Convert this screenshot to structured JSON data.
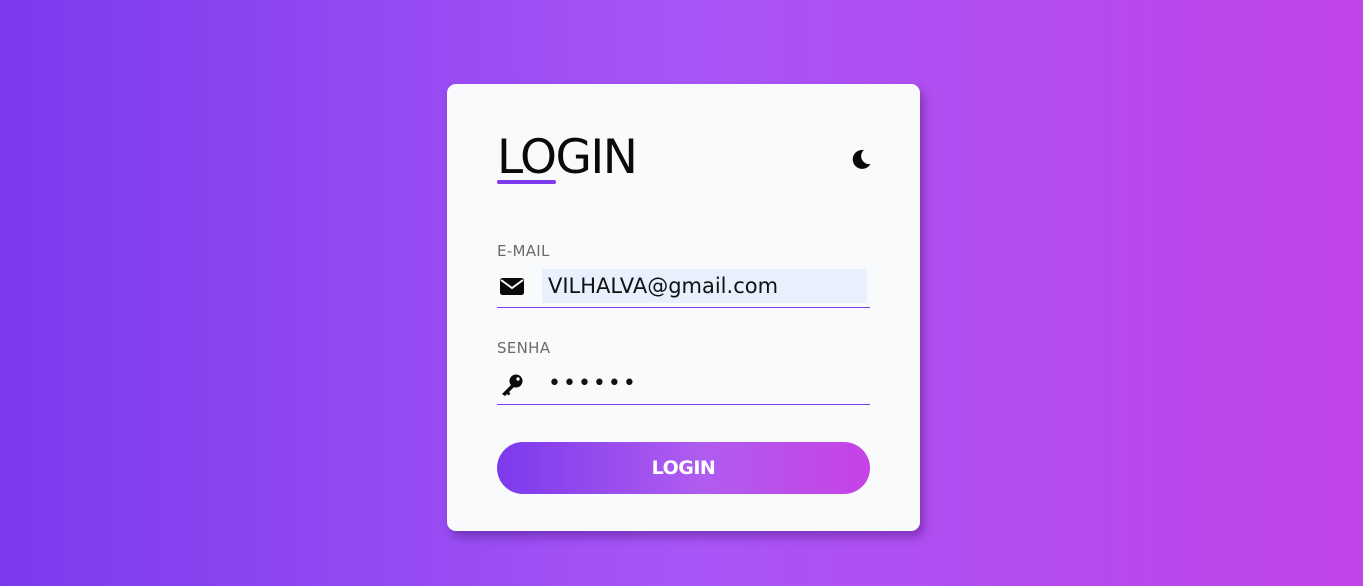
{
  "login_card": {
    "title": "LOGIN",
    "theme_toggle_icon": "moon-icon",
    "email": {
      "label": "E-MAIL",
      "icon": "envelope-icon",
      "value": "VILHALVA@gmail.com"
    },
    "password": {
      "label": "SENHA",
      "icon": "key-icon",
      "value": "••••••"
    },
    "submit_label": "LOGIN"
  },
  "colors": {
    "accent": "#7c3aed",
    "gradient_end": "#c044e8",
    "card_background": "#f8fafc",
    "autofill_background": "#e8f0fe"
  }
}
